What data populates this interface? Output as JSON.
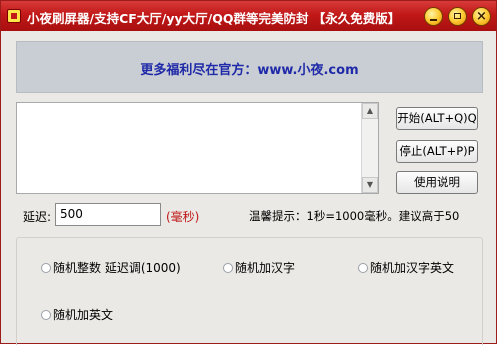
{
  "window": {
    "title": "小夜刷屏器/支持CF大厅/yy大厅/QQ群等完美防封 【永久免费版】"
  },
  "titlebar_buttons": {
    "minimize_icon": "minimize-icon",
    "maximize_icon": "maximize-icon",
    "close_icon": "close-icon",
    "close_glyph": "×"
  },
  "banner": {
    "text": "更多福利尽在官方：www.小夜.com"
  },
  "buttons": {
    "start": "开始(ALT+Q)Q",
    "stop": "停止(ALT+P)P",
    "help": "使用说明"
  },
  "delay": {
    "label": "延迟:",
    "value": "500",
    "unit": "(毫秒)"
  },
  "tip": "温馨提示：1秒=1000毫秒。建议高于50",
  "options": [
    {
      "label": "随机整数 延迟调(1000)"
    },
    {
      "label": "随机加汉字"
    },
    {
      "label": "随机加汉字英文"
    },
    {
      "label": "随机加英文"
    }
  ],
  "colors": {
    "titlebar": "#c21818",
    "banner_text": "#1f2aa8",
    "unit_text": "#c01818"
  }
}
